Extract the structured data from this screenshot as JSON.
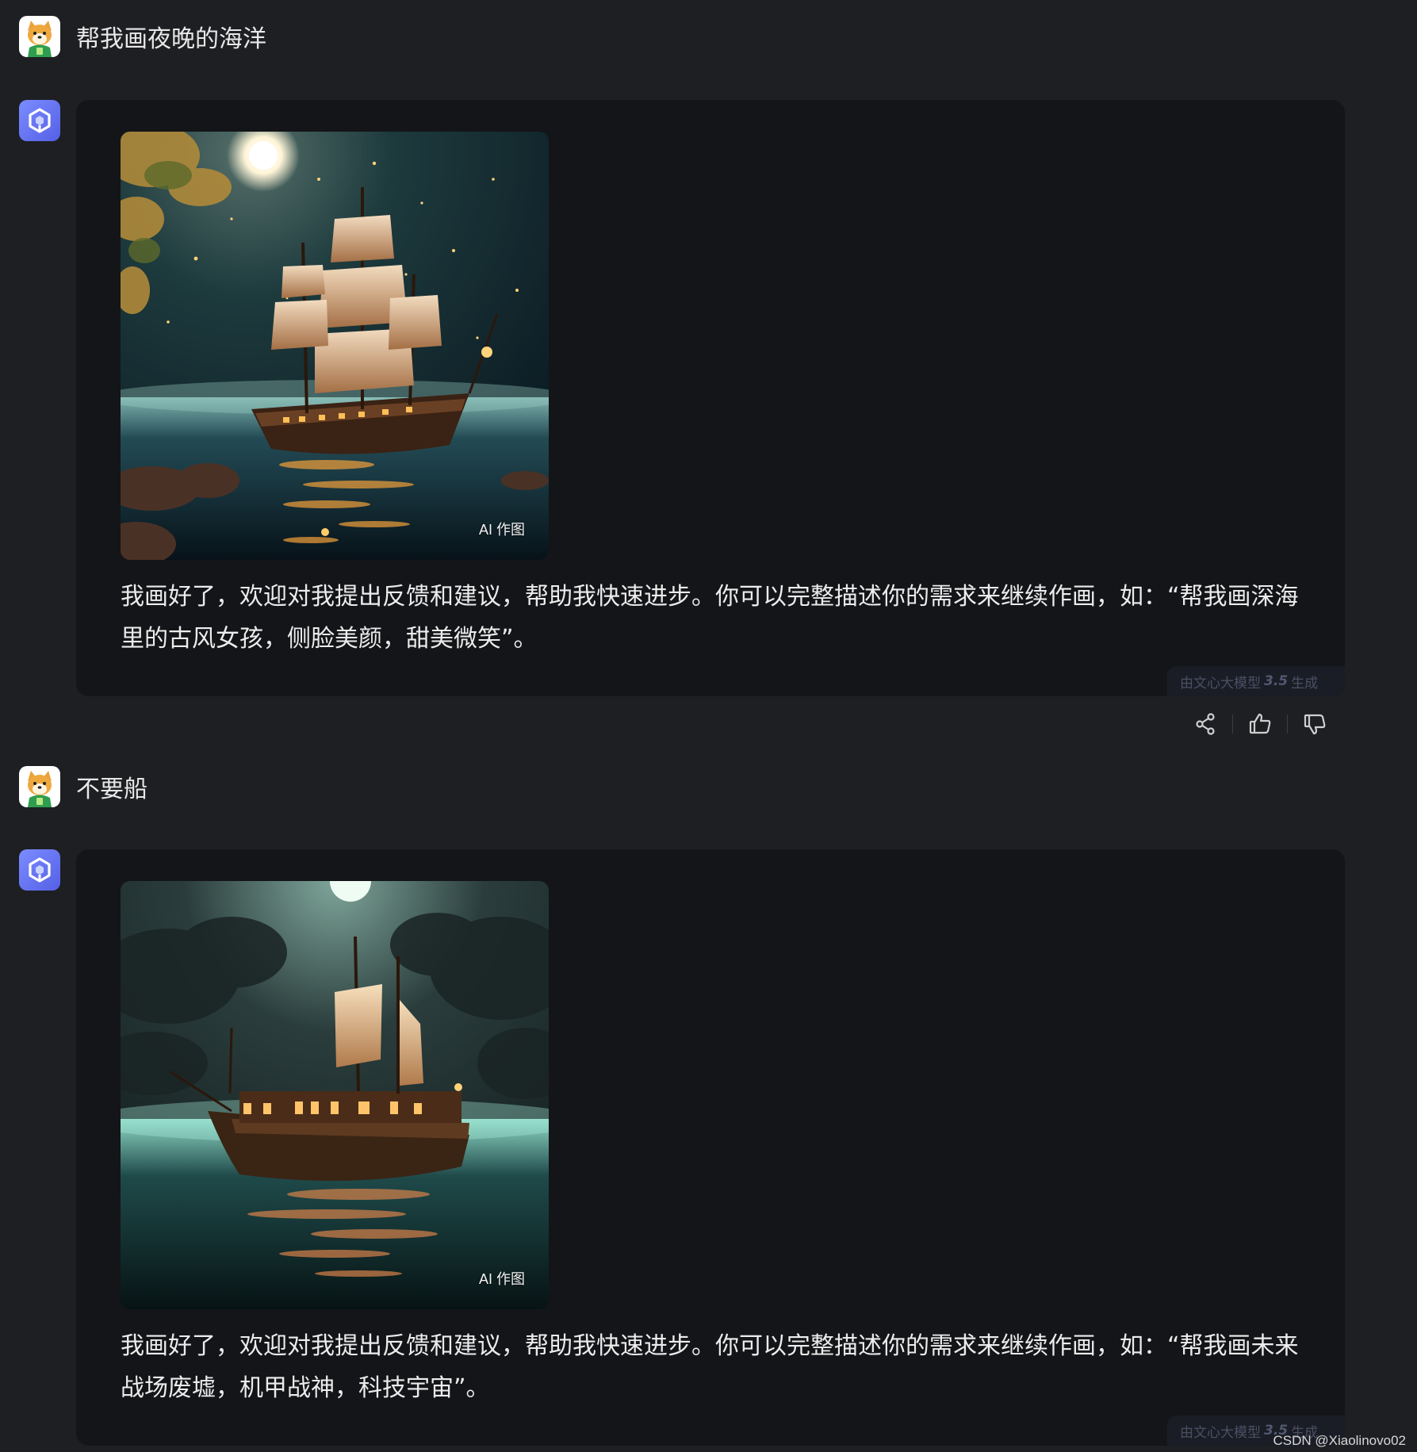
{
  "messages": [
    {
      "user_text": "帮我画夜晚的海洋",
      "ai_badge": "AI 作图",
      "reply": "我画好了，欢迎对我提出反馈和建议，帮助我快速进步。你可以完整描述你的需求来继续作画，如：“帮我画深海里的古风女孩，侧脸美颜，甜美微笑”。",
      "gen_prefix": "由文心大模型",
      "gen_version": "3.5",
      "gen_suffix": "生成"
    },
    {
      "user_text": "不要船",
      "ai_badge": "AI 作图",
      "reply": "我画好了，欢迎对我提出反馈和建议，帮助我快速进步。你可以完整描述你的需求来继续作画，如：“帮我画未来战场废墟，机甲战神，科技宇宙”。",
      "gen_prefix": "由文心大模型",
      "gen_version": "3.5",
      "gen_suffix": "生成"
    }
  ],
  "icons": {
    "share": "share-icon",
    "thumbs_up": "thumbs-up-icon",
    "thumbs_down": "thumbs-down-icon",
    "user_avatar": "shiba-dog-avatar",
    "bot_avatar": "ernie-cube-logo"
  },
  "watermark": "CSDN @Xiaolinovo02",
  "colors": {
    "background": "#1e1f22",
    "card": "#141518",
    "bot_avatar": "#6a7bf0"
  }
}
